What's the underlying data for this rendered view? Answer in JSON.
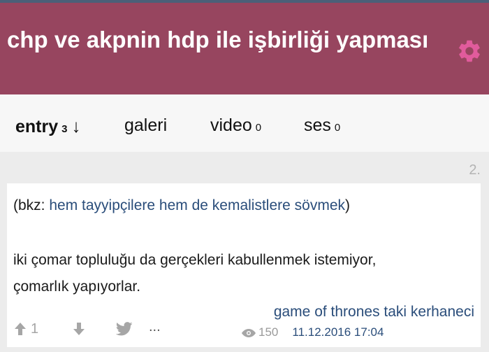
{
  "header": {
    "title": "chp ve akpnin hdp ile işbirliği yapması",
    "settings_icon": "gear-icon",
    "colors": {
      "background": "#97455f",
      "accent_top": "#4b5f78"
    }
  },
  "tabs": [
    {
      "label": "entry",
      "count": "3",
      "active": true,
      "sort_indicator": "↓"
    },
    {
      "label": "galeri"
    },
    {
      "label": "video",
      "count": "0"
    },
    {
      "label": "ses",
      "count": "0"
    }
  ],
  "entry": {
    "number": "2.",
    "bkz_prefix": "(bkz: ",
    "bkz_link": "hem tayyipçilere hem de kemalistlere sövmek",
    "bkz_suffix": ")",
    "body_lines": [
      "iki çomar topluluğu da gerçekleri kabullenmek istemiyor,",
      "çomarlık yapıyorlar."
    ],
    "author": "game of thrones taki kerhaneci",
    "upvotes": "1",
    "views": "150",
    "date": "11.12.2016 17:04",
    "more_label": "...",
    "icons": [
      "arrow-up-icon",
      "arrow-down-icon",
      "twitter-icon",
      "eye-icon"
    ]
  }
}
